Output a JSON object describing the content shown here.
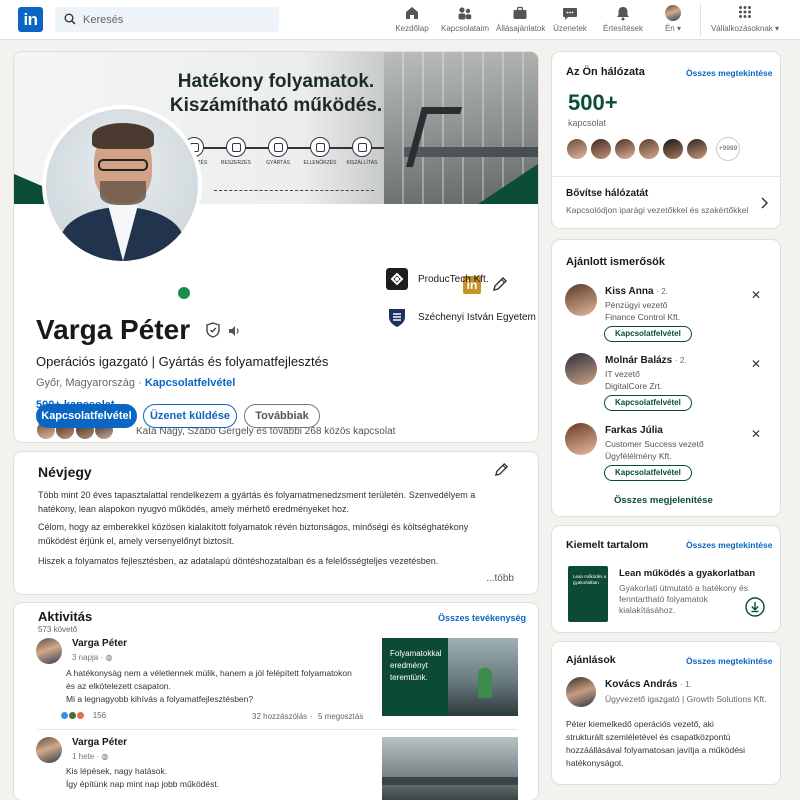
{
  "nav": {
    "logo": "in",
    "search_placeholder": "Keresés",
    "items": [
      {
        "label": "Kezdőlap",
        "icon": "home-icon"
      },
      {
        "label": "Kapcsolataim",
        "icon": "network-icon"
      },
      {
        "label": "Állásajánlatok",
        "icon": "jobs-icon"
      },
      {
        "label": "Üzenetek",
        "icon": "messaging-icon"
      },
      {
        "label": "Értesítések",
        "icon": "bell-icon"
      },
      {
        "label": "Én",
        "icon": "me-avatar"
      },
      {
        "label": "Vállalkozásoknak",
        "icon": "grid-icon"
      }
    ]
  },
  "colors": {
    "brand": "#0a66c2",
    "accent_green": "#0b4d36",
    "background": "#f3f2ef"
  },
  "profile": {
    "banner_title_1": "Hatékony folyamatok.",
    "banner_title_2": "Kiszámítható működés.",
    "banner_steps": [
      "TERVEZÉS",
      "BESZERZÉS",
      "GYÁRTÁS",
      "ELLENŐRZÉS",
      "KISZÁLLÍTÁS"
    ],
    "name": "Varga Péter",
    "headline": "Operációs igazgató | Gyártás és folyamatfejlesztés",
    "location": "Győr, Magyarország",
    "contact_link": "Kapcsolatfelvétel",
    "connections": "500+ kapcsolat",
    "mutual": "Kata Nagy, Szabó Gergely és további 268 közös kapcsolat",
    "buttons": {
      "connect": "Kapcsolatfelvétel",
      "message": "Üzenet küldése",
      "more": "Továbbiak"
    },
    "orgs": [
      {
        "name": "ProducTech Kft."
      },
      {
        "name": "Széchenyi István Egyetem"
      }
    ]
  },
  "about": {
    "title": "Névjegy",
    "p1": "Több mint 20 éves tapasztalattal rendelkezem a gyártás és folyamatmenedzsment területén. Szenvedélyem a hatékony, lean alapokon nyugvó működés, amely mérhető eredményeket hoz.",
    "p2": "Célom, hogy az emberekkel közösen kialakított folyamatok révén biztonságos, minőségi és költséghatékony működést érjünk el, amely versenyelőnyt biztosít.",
    "p3": "Hiszek a folyamatos fejlesztésben, az adatalapú döntéshozatalban és a felelősségteljes vezetésben.",
    "more": "...több"
  },
  "activity": {
    "title": "Aktivitás",
    "followers": "573 követő",
    "all_link": "Összes tevékenység",
    "posts": [
      {
        "author": "Varga Péter",
        "time": "3 napja · ",
        "body_1": "A hatékonyság nem a véletlennek múlik, hanem a jól felépített folyamatokon",
        "body_2": "és az elkötelezett csapaton.",
        "body_3": "Mi a legnagyobb kihívás a folyamatfejlesztésben?",
        "reactions": "156",
        "comments": "32 hozzászólás",
        "shares": "5 megosztás",
        "image_text": "Folyamatokkal eredményt teremtünk."
      },
      {
        "author": "Varga Péter",
        "time": "1 hete · ",
        "body_1": "Kis lépések, nagy hatások.",
        "body_2": "Így építünk nap mint nap jobb működést."
      }
    ]
  },
  "network": {
    "title": "Az Ön hálózata",
    "see_all": "Összes megtekintése",
    "count": "500+",
    "count_label": "kapcsolat",
    "extra": "+9999",
    "grow_title": "Bővítse hálózatát",
    "grow_sub": "Kapcsolódjon iparági vezetőkkel és szakértőkkel"
  },
  "suggestions": {
    "title": "Ajánlott ismerősök",
    "connect_label": "Kapcsolatfelvétel",
    "people": [
      {
        "name": "Kiss Anna",
        "degree": "· 2.",
        "role": "Pénzügyi vezető",
        "company": "Finance Control Kft."
      },
      {
        "name": "Molnár Balázs",
        "degree": "· 2.",
        "role": "IT vezető",
        "company": "DigitalCore Zrt."
      },
      {
        "name": "Farkas Júlia",
        "degree": "· 2.",
        "role": "Customer Success vezető",
        "company": "Ügyfélélmény Kft."
      }
    ],
    "show_all": "Összes megjelenítése"
  },
  "featured": {
    "title": "Kiemelt tartalom",
    "see_all": "Összes megtekintése",
    "item_title": "Lean működés a gyakorlatban",
    "item_desc_1": "Gyakorlati útmutató a hatékony és",
    "item_desc_2": "fenntartható folyamatok",
    "item_desc_3": "kialakításához.",
    "book_text": "Lean működés a gyakorlatban"
  },
  "recommendations": {
    "title": "Ajánlások",
    "see_all": "Összes megtekintése",
    "name": "Kovács András",
    "degree": "· 1.",
    "role": "Ügyvezető igazgató | Growth Solutions Kft.",
    "text_1": "Péter kiemelkedő operációs vezető, aki",
    "text_2": "strukturált szemléletével és csapatközpontú",
    "text_3": "hozzáállásával folyamatosan javítja a működési",
    "text_4": "hatékonyságot."
  }
}
